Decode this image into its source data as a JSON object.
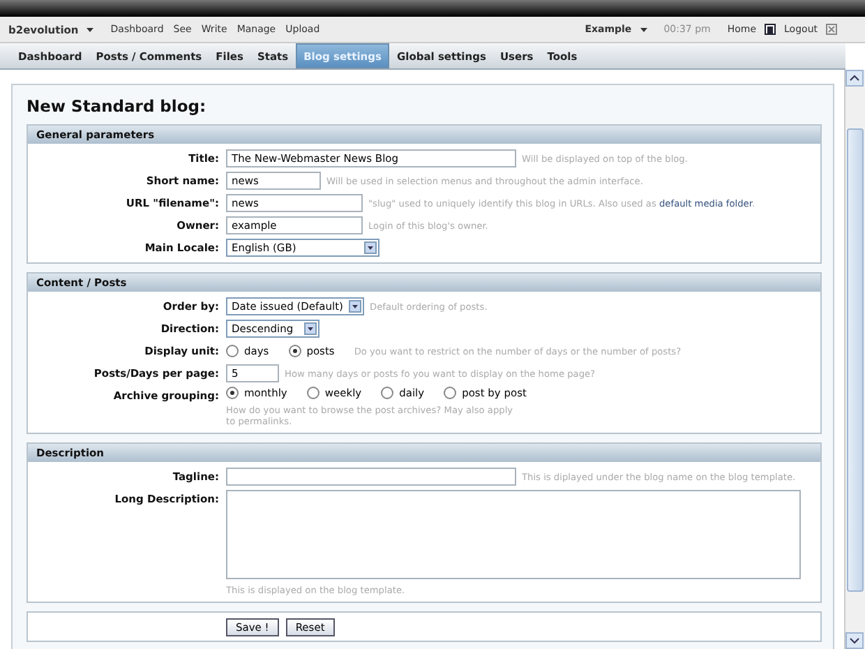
{
  "top_menu": {
    "brand": "b2evolution",
    "items": [
      "Dashboard",
      "See",
      "Write",
      "Manage",
      "Upload"
    ],
    "user": "Example",
    "time": "00:37 pm",
    "home": "Home",
    "logout": "Logout"
  },
  "tabs": [
    {
      "label": "Dashboard",
      "selected": false
    },
    {
      "label": "Posts / Comments",
      "selected": false
    },
    {
      "label": "Files",
      "selected": false
    },
    {
      "label": "Stats",
      "selected": false
    },
    {
      "label": "Blog settings",
      "selected": true
    },
    {
      "label": "Global settings",
      "selected": false
    },
    {
      "label": "Users",
      "selected": false
    },
    {
      "label": "Tools",
      "selected": false
    }
  ],
  "page_title": "New Standard blog:",
  "sections": [
    {
      "title": "General parameters",
      "fields": [
        {
          "kind": "text",
          "label": "Title:",
          "value": "The New-Webmaster News Blog",
          "hint": "Will be displayed on top of the blog."
        },
        {
          "kind": "text",
          "label": "Short name:",
          "value": "news",
          "hint": "Will be used in selection menus and throughout the admin interface."
        },
        {
          "kind": "text",
          "label": "URL \"filename\":",
          "value": "news",
          "hint": "\"slug\" used to uniquely identify this blog in URLs. Also used as",
          "hint_link": "default media folder",
          "hint_end": "."
        },
        {
          "kind": "text",
          "label": "Owner:",
          "value": "example",
          "hint": "Login of this blog's owner."
        },
        {
          "kind": "select",
          "label": "Main Locale:",
          "value": "English (GB)"
        }
      ]
    },
    {
      "title": "Content / Posts",
      "fields": [
        {
          "kind": "select",
          "label": "Order by:",
          "value": "Date issued (Default)",
          "hint": "Default ordering of posts."
        },
        {
          "kind": "select",
          "label": "Direction:",
          "value": "Descending"
        },
        {
          "kind": "radio",
          "label": "Display unit:",
          "options": [
            {
              "label": "days",
              "selected": false
            },
            {
              "label": "posts",
              "selected": true
            }
          ],
          "hint": "Do you want to restrict on the number of days or the number of posts?"
        },
        {
          "kind": "text",
          "label": "Posts/Days per page:",
          "value": "5",
          "hint": "How many days or posts fo you want to display on the home page?"
        },
        {
          "kind": "radio",
          "label": "Archive grouping:",
          "options": [
            {
              "label": "monthly",
              "selected": true
            },
            {
              "label": "weekly",
              "selected": false
            },
            {
              "label": "daily",
              "selected": false
            },
            {
              "label": "post by post",
              "selected": false
            }
          ],
          "hint": "How do you want to browse the post archives? May also apply to permalinks."
        }
      ]
    },
    {
      "title": "Description",
      "fields": [
        {
          "kind": "text",
          "label": "Tagline:",
          "hint": "This is diplayed under the blog name on the blog template."
        },
        {
          "kind": "textarea",
          "label": "Long Description:",
          "hint": "This is displayed on the blog template."
        }
      ]
    }
  ],
  "buttons": [
    "Save !",
    "Reset"
  ]
}
